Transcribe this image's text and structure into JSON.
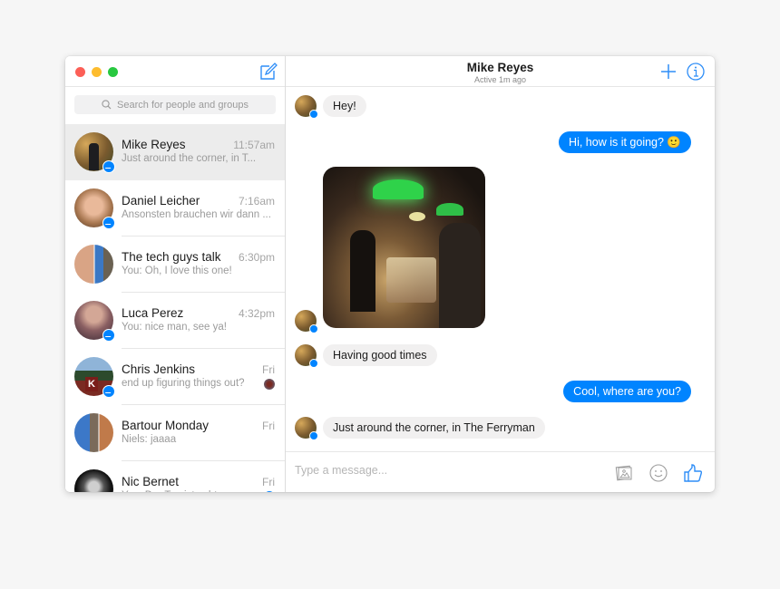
{
  "window": {
    "traffic_lights": [
      {
        "name": "close",
        "color": "#fc5f57"
      },
      {
        "name": "minimize",
        "color": "#fdbc2e"
      },
      {
        "name": "maximize",
        "color": "#28c840"
      }
    ],
    "accent_color": "#0084ff"
  },
  "sidebar": {
    "compose_icon": "compose-icon",
    "search": {
      "placeholder": "Search for people and groups",
      "icon": "search-icon"
    },
    "conversations": [
      {
        "name": "Mike Reyes",
        "time": "11:57am",
        "preview": "Just around the corner, in T...",
        "selected": true,
        "messenger_badge": true
      },
      {
        "name": "Daniel Leicher",
        "time": "7:16am",
        "preview": "Ansonsten brauchen wir dann ...",
        "selected": false,
        "messenger_badge": true
      },
      {
        "name": "The tech guys talk",
        "time": "6:30pm",
        "preview": "You: Oh, I love this one!",
        "selected": false,
        "messenger_badge": false
      },
      {
        "name": "Luca Perez",
        "time": "4:32pm",
        "preview": "You: nice man, see ya!",
        "selected": false,
        "messenger_badge": true
      },
      {
        "name": "Chris Jenkins",
        "time": "Fri",
        "preview": "end up figuring things out?",
        "selected": false,
        "messenger_badge": true
      },
      {
        "name": "Bartour Monday",
        "time": "Fri",
        "preview": "Niels: jaaaa",
        "selected": false,
        "messenger_badge": false
      },
      {
        "name": "Nic Bernet",
        "time": "Fri",
        "preview": "You: Der Typ ist echt ...",
        "selected": false,
        "messenger_badge": false
      }
    ]
  },
  "chat": {
    "title": "Mike Reyes",
    "status": "Active 1m ago",
    "add_icon": "plus-icon",
    "info_icon": "info-icon",
    "messages": [
      {
        "from": "them",
        "type": "text",
        "text": "Hey!"
      },
      {
        "from": "me",
        "type": "text",
        "text": "Hi, how is it going? 🙂"
      },
      {
        "from": "them",
        "type": "photo",
        "text": "bar-photo"
      },
      {
        "from": "them",
        "type": "text",
        "text": "Having good times"
      },
      {
        "from": "me",
        "type": "text",
        "text": "Cool, where are you?"
      },
      {
        "from": "them",
        "type": "text",
        "text": "Just around the corner, in The Ferryman"
      }
    ],
    "composer": {
      "placeholder": "Type a message...",
      "icons": [
        "image-icon",
        "emoji-icon",
        "thumbs-up-icon"
      ]
    }
  }
}
